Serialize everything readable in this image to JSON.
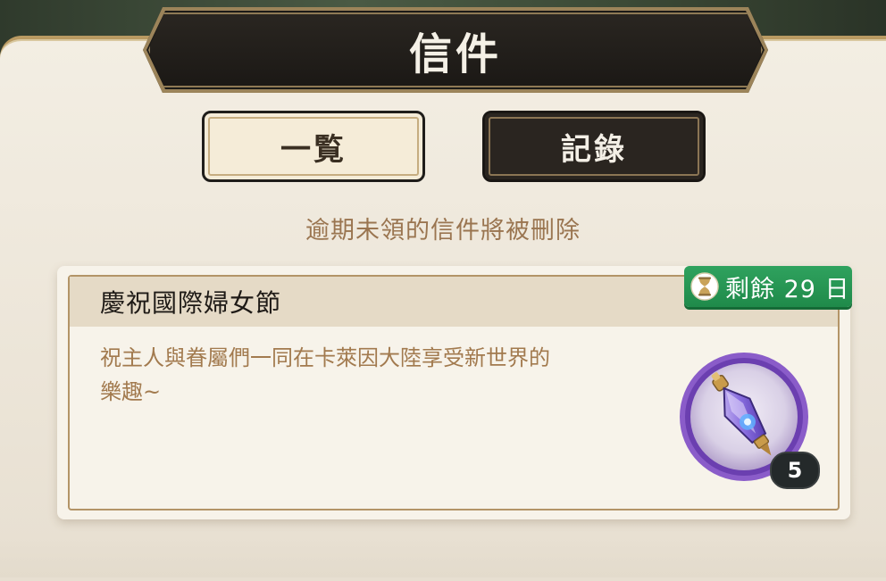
{
  "header": {
    "title": "信件"
  },
  "tabs": [
    {
      "label": "一覧",
      "selected": true
    },
    {
      "label": "記錄",
      "selected": false
    }
  ],
  "notice": "逾期未領的信件將被刪除",
  "mail": {
    "title": "慶祝國際婦女節",
    "body_line1": "祝主人與眷屬們一同在卡萊因大陸享受新世界的",
    "body_line2": "樂趣~",
    "remaining_days_label": "剩餘 29 日",
    "attachment": {
      "icon": "purple-potion-icon",
      "count": "5"
    }
  },
  "colors": {
    "accent_gold": "#b39467",
    "badge_green": "#2fa25e",
    "body_text": "#a27a4e"
  }
}
